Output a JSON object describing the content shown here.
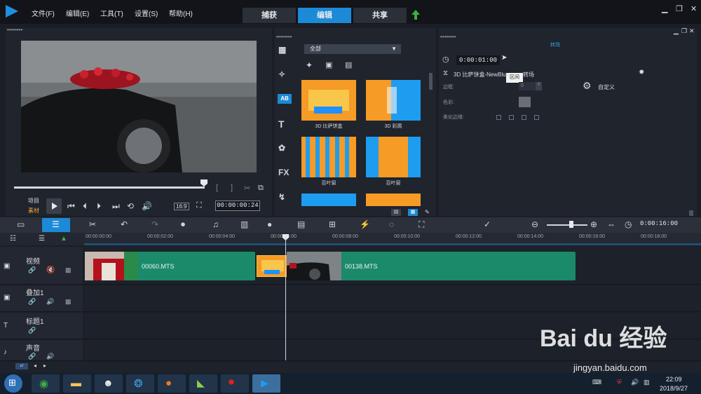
{
  "menu": [
    "文件(F)",
    "编辑(E)",
    "工具(T)",
    "设置(S)",
    "帮助(H)"
  ],
  "stage_tabs": [
    "捕获",
    "编辑",
    "共享"
  ],
  "window_controls": [
    "▁",
    "❐",
    "✕"
  ],
  "player": {
    "project_label": "项目",
    "clip_label": "素材",
    "aspect": "16:9",
    "timecode": "00:00:00:24"
  },
  "library": {
    "filter": "全部",
    "items": [
      "3D 比萨饼盒",
      "3D 彩屑",
      "百叶窗",
      "百叶窗"
    ],
    "side_icons": [
      "AB",
      "T",
      "FX"
    ]
  },
  "options": {
    "duration": "0:00:01:00",
    "tooltip": "区间",
    "transition_name": "3D 比萨饼盒-NewBlue",
    "transition_suffix": "转场",
    "tab_label": "转场",
    "border_label": "边框:",
    "border_value": "0",
    "color_label": "色彩:",
    "soften_label": "柔化边缘:",
    "customize_label": "自定义"
  },
  "toolbar": {
    "project_length": "0:00:16:00"
  },
  "ruler_ticks": [
    "00:00:00:00",
    "00:00:02:00",
    "00:00:04:00",
    "00:00:06:00",
    "00:00:08:00",
    "00:00:10:00",
    "00:00:12:00",
    "00:00:14:00",
    "00:00:16:00",
    "00:00:18:00"
  ],
  "tracks": [
    {
      "name": "视频"
    },
    {
      "name": "叠加1"
    },
    {
      "name": "标题1"
    },
    {
      "name": "声音"
    }
  ],
  "clips": [
    {
      "label": "00060.MTS"
    },
    {
      "label": "00138.MTS"
    }
  ],
  "taskbar": {
    "time": "22:09",
    "date": "2018/9/27"
  },
  "watermark": {
    "text": "Bai du 经验",
    "url": "jingyan.baidu.com"
  },
  "colors": {
    "accent": "#1c8ad6",
    "clip": "#1a8a6b",
    "thumb": "#f59b26"
  }
}
